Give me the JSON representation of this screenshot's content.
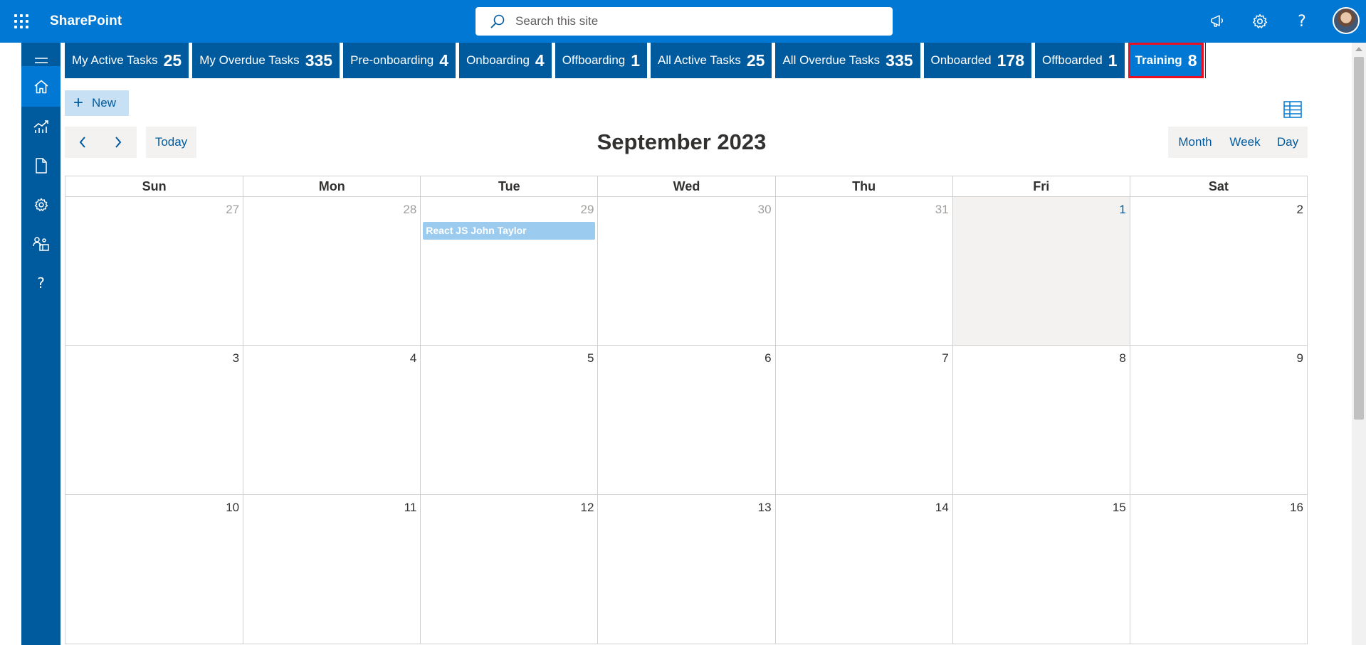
{
  "header": {
    "brand": "SharePoint",
    "search_placeholder": "Search this site",
    "icons": [
      "app-launcher-icon",
      "megaphone-icon",
      "gear-icon",
      "help-icon",
      "avatar"
    ]
  },
  "rail": {
    "items": [
      "menu-icon",
      "home-icon",
      "chart-icon",
      "document-icon",
      "settings-icon",
      "people-icon",
      "help-icon"
    ]
  },
  "tabs": [
    {
      "label": "My Active Tasks",
      "count": "25"
    },
    {
      "label": "My Overdue Tasks",
      "count": "335"
    },
    {
      "label": "Pre-onboarding",
      "count": "4"
    },
    {
      "label": "Onboarding",
      "count": "4"
    },
    {
      "label": "Offboarding",
      "count": "1"
    },
    {
      "label": "All Active Tasks",
      "count": "25"
    },
    {
      "label": "All Overdue Tasks",
      "count": "335"
    },
    {
      "label": "Onboarded",
      "count": "178"
    },
    {
      "label": "Offboarded",
      "count": "1"
    },
    {
      "label": "Training",
      "count": "8"
    }
  ],
  "toolbar": {
    "new_label": "New",
    "today_label": "Today"
  },
  "calendar": {
    "title": "September 2023",
    "views": [
      "Month",
      "Week",
      "Day"
    ],
    "days_of_week": [
      "Sun",
      "Mon",
      "Tue",
      "Wed",
      "Thu",
      "Fri",
      "Sat"
    ],
    "weeks": [
      [
        "27",
        "28",
        "29",
        "30",
        "31",
        "1",
        "2"
      ],
      [
        "3",
        "4",
        "5",
        "6",
        "7",
        "8",
        "9"
      ],
      [
        "10",
        "11",
        "12",
        "13",
        "14",
        "15",
        "16"
      ]
    ],
    "event": {
      "title": "React JS John Taylor"
    }
  },
  "colors": {
    "brand_blue": "#0078d4",
    "dark_blue": "#005a9e",
    "selected_outline": "#e81123",
    "event_fill": "#9ccbf0"
  }
}
